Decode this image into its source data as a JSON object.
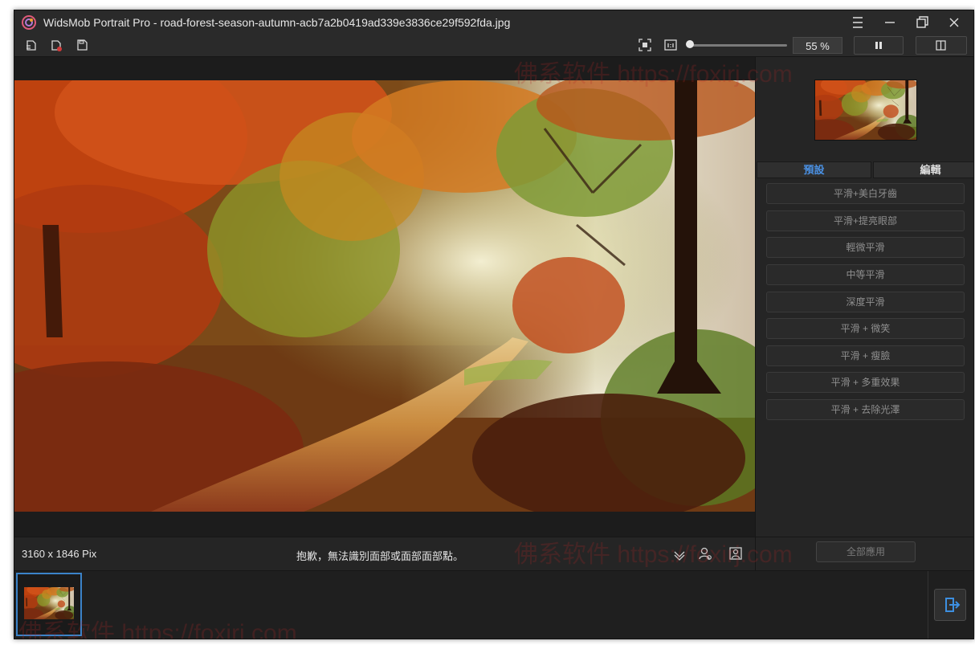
{
  "window": {
    "title": "WidsMob Portrait Pro - road-forest-season-autumn-acb7a2b0419ad339e3836ce29f592fda.jpg"
  },
  "titlebar_buttons": [
    "menu-icon",
    "minimize-icon",
    "restore-icon",
    "close-icon"
  ],
  "toolbar": {
    "left_icons": [
      "open-image-icon",
      "remove-image-icon",
      "save-icon"
    ],
    "fit_icon": "fit-screen-icon",
    "actual_size_icon": "actual-size-icon",
    "zoom": "55 %",
    "zoom_fraction": 0.0,
    "pause_icon": "pause-icon",
    "compare_icon": "compare-icon"
  },
  "panel": {
    "tabs": [
      {
        "label": "預設",
        "active": true
      },
      {
        "label": "編輯",
        "active": false
      }
    ],
    "presets": [
      "平滑+美白牙齒",
      "平滑+提亮眼部",
      "輕微平滑",
      "中等平滑",
      "深度平滑",
      "平滑 + 微笑",
      "平滑 + 瘦臉",
      "平滑 + 多重效果",
      "平滑 + 去除光澤"
    ],
    "apply_all": "全部應用"
  },
  "status": {
    "dimensions": "3160 x 1846 Pix",
    "message": "抱歉，無法識別面部或面部面部點。"
  },
  "status_icons": [
    "download-icon",
    "person-settings-icon",
    "portrait-icon"
  ],
  "export_icon": "export-icon",
  "watermark": "佛系软件 https://foxirj.com",
  "colors": {
    "active_tab": "#4a90e2",
    "inactive_tab": "#e0e0e0",
    "selected_thumb_border": "#3b83c9",
    "export_arrow": "#3d8fe0"
  }
}
